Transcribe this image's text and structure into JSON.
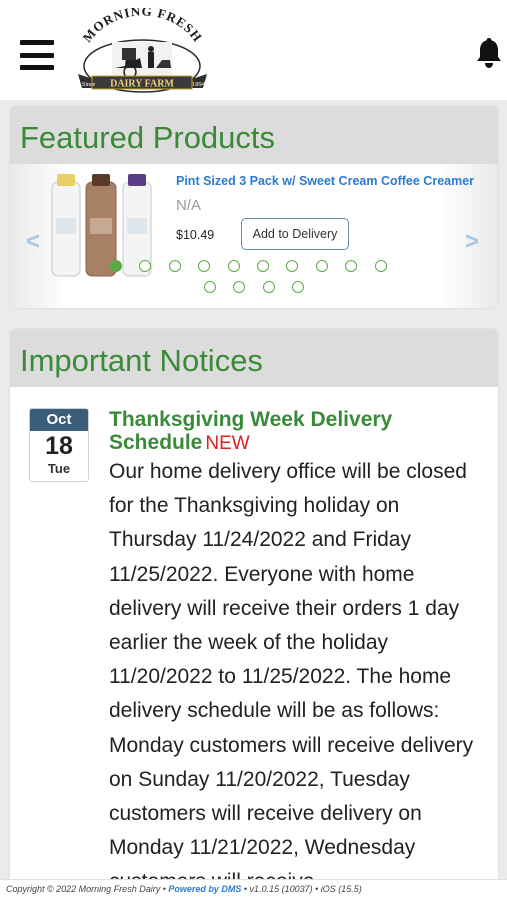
{
  "header": {
    "logo": {
      "top_text": "MORNING FRESH",
      "ribbon_text": "DAIRY FARM",
      "since": "Since",
      "year": "1894"
    }
  },
  "featured": {
    "heading": "Featured Products",
    "product": {
      "title": "Pint Sized 3 Pack w/ Sweet Cream Coffee Creamer",
      "subtitle": "N/A",
      "price": "$10.49",
      "add_label": "Add to Delivery"
    },
    "carousel": {
      "total_slides": 14,
      "active_index": 0
    },
    "colors": {
      "accent": "#5aab46",
      "heading": "#3a8a3a",
      "link": "#2b7bd1",
      "arrow": "#a9c6e6"
    }
  },
  "notices": {
    "heading": "Important Notices",
    "items": [
      {
        "month": "Oct",
        "day": "18",
        "weekday": "Tue",
        "title": "Thanksgiving Week Delivery Schedule",
        "badge": "NEW",
        "body": "Our home delivery office will be closed for the Thanksgiving holiday on Thursday 11/24/2022 and Friday 11/25/2022. Everyone with home delivery will receive their orders 1 day earlier the week of the holiday 11/20/2022 to 11/25/2022. The home delivery schedule will be as follows: Monday customers will receive delivery on Sunday 11/20/2022, Tuesday customers will receive delivery on Monday 11/21/2022, Wednesday customers will receive"
      }
    ]
  },
  "footer": {
    "copyright": "Copyright © 2022 Morning Fresh Dairy •",
    "powered": "Powered by DMS",
    "version": "• v1.0.15 (10037) • iOS (15.5)"
  },
  "icons": [
    "menu-icon",
    "notification-bell-icon",
    "chevron-left-icon",
    "chevron-right-icon"
  ]
}
